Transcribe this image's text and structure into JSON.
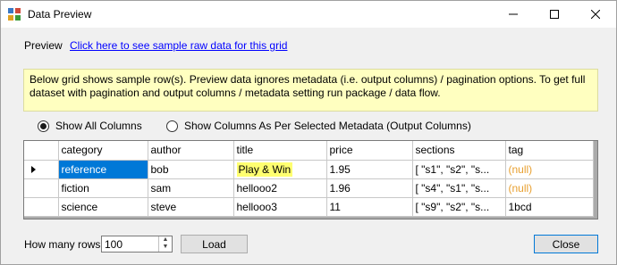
{
  "window": {
    "title": "Data Preview"
  },
  "preview": {
    "label": "Preview",
    "link": "Click here to see sample raw data for this grid"
  },
  "info": {
    "text": "Below grid shows sample row(s). Preview data ignores metadata (i.e. output columns) / pagination options. To get full dataset with pagination and output columns / metadata setting run package / data flow."
  },
  "options": {
    "show_all": "Show All Columns",
    "show_selected": "Show Columns As Per Selected Metadata (Output Columns)"
  },
  "grid": {
    "columns": [
      "category",
      "author",
      "title",
      "price",
      "sections",
      "tag"
    ],
    "rows": [
      [
        "reference",
        "bob",
        "Play & Win",
        "1.95",
        "[ \"s1\", \"s2\", \"s...",
        "(null)"
      ],
      [
        "fiction",
        "sam",
        "hellooo2",
        "1.96",
        "[ \"s4\", \"s1\", \"s...",
        "(null)"
      ],
      [
        "science",
        "steve",
        "hellooo3",
        "11",
        "[ \"s9\", \"s2\", \"s...",
        "1bcd"
      ]
    ]
  },
  "footer": {
    "rows_label": "How many rows",
    "rows_value": "100",
    "load_label": "Load",
    "close_label": "Close"
  },
  "colors": {
    "selection": "#0078d7",
    "info_bg": "#ffffc0",
    "null_text": "#e8a030",
    "highlight": "#ffff70"
  }
}
